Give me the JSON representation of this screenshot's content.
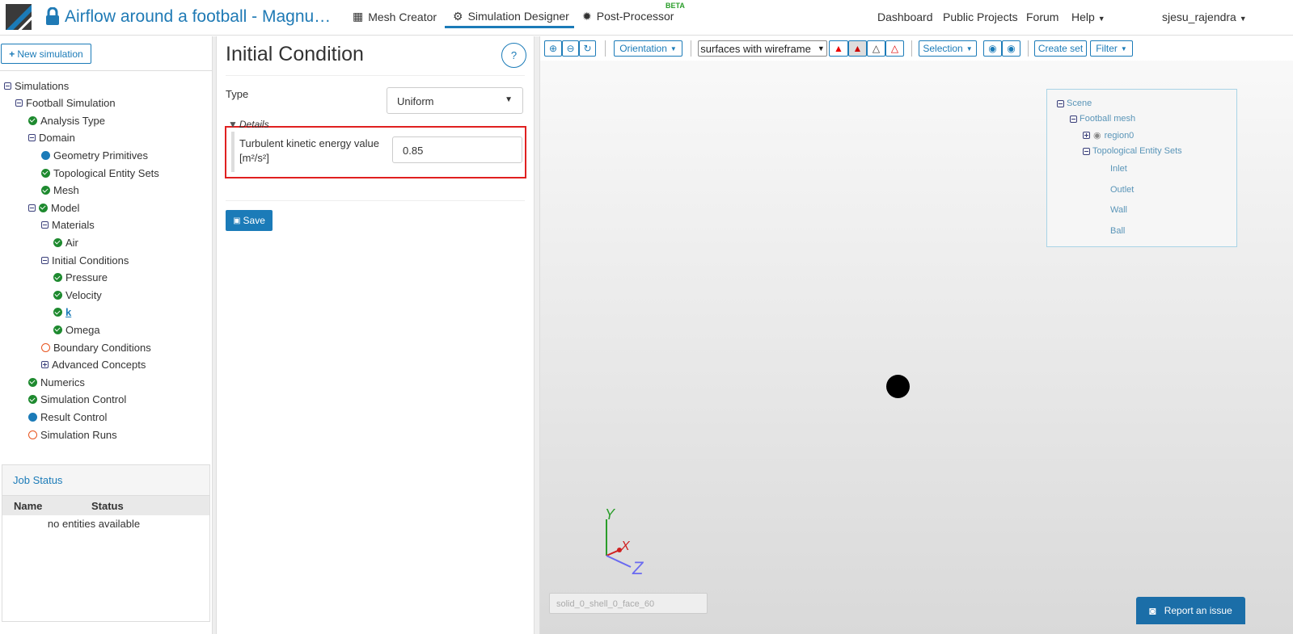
{
  "header": {
    "title": "Airflow around a football - Magnu…",
    "nav": [
      {
        "label": "Mesh Creator"
      },
      {
        "label": "Simulation Designer"
      },
      {
        "label": "Post-Processor"
      }
    ],
    "beta": "BETA",
    "right": [
      "Dashboard",
      "Public Projects",
      "Forum",
      "Help"
    ],
    "user": "sjesu_rajendra"
  },
  "left": {
    "new_simulation": "New simulation",
    "tree": [
      {
        "label": "Simulations",
        "level": 0,
        "icon": "minus"
      },
      {
        "label": "Football Simulation",
        "level": 1,
        "icon": "minus"
      },
      {
        "label": "Analysis Type",
        "level": 2,
        "icon": "check"
      },
      {
        "label": "Domain",
        "level": 2,
        "icon": "minus"
      },
      {
        "label": "Geometry Primitives",
        "level": 3,
        "icon": "dot"
      },
      {
        "label": "Topological Entity Sets",
        "level": 3,
        "icon": "check"
      },
      {
        "label": "Mesh",
        "level": 3,
        "icon": "check"
      },
      {
        "label": "Model",
        "level": 2,
        "icon": "minus+check"
      },
      {
        "label": "Materials",
        "level": 3,
        "icon": "minus"
      },
      {
        "label": "Air",
        "level": 4,
        "icon": "check"
      },
      {
        "label": "Initial Conditions",
        "level": 3,
        "icon": "minus"
      },
      {
        "label": "Pressure",
        "level": 4,
        "icon": "check"
      },
      {
        "label": "Velocity",
        "level": 4,
        "icon": "check"
      },
      {
        "label": "k",
        "level": 4,
        "icon": "check",
        "selected": true
      },
      {
        "label": "Omega",
        "level": 4,
        "icon": "check"
      },
      {
        "label": "Boundary Conditions",
        "level": 3,
        "icon": "ring"
      },
      {
        "label": "Advanced Concepts",
        "level": 3,
        "icon": "plus"
      },
      {
        "label": "Numerics",
        "level": 2,
        "icon": "check"
      },
      {
        "label": "Simulation Control",
        "level": 2,
        "icon": "check"
      },
      {
        "label": "Result Control",
        "level": 2,
        "icon": "dot"
      },
      {
        "label": "Simulation Runs",
        "level": 2,
        "icon": "ring"
      }
    ],
    "job_status": {
      "title": "Job Status",
      "columns": [
        "Name",
        "Status"
      ],
      "empty": "no entities available"
    }
  },
  "form": {
    "title": "Initial Condition",
    "help": "?",
    "type_label": "Type",
    "type_value": "Uniform",
    "details": "Details",
    "field_label": "Turbulent kinetic energy value [m²/s²]",
    "field_value": "0.85",
    "save": "Save"
  },
  "viewer": {
    "orientation": "Orientation",
    "render_mode": "surfaces with wireframe",
    "selection": "Selection",
    "create_set": "Create set",
    "filter": "Filter",
    "scene": {
      "root": "Scene",
      "mesh": "Football mesh",
      "region": "region0",
      "sets_label": "Topological Entity Sets",
      "sets": [
        "Inlet",
        "Outlet",
        "Wall",
        "Ball"
      ]
    },
    "axes": {
      "x": "X",
      "y": "Y",
      "z": "Z"
    },
    "face_label": "solid_0_shell_0_face_60",
    "report": "Report an issue"
  }
}
